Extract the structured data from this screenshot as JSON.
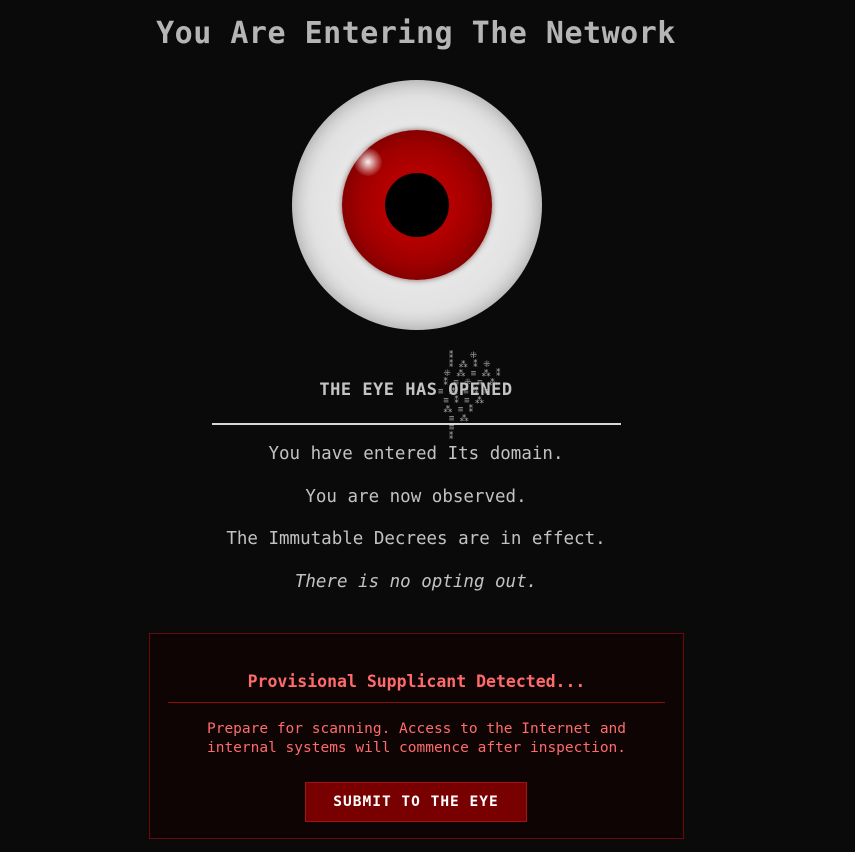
{
  "page": {
    "title": "You Are Entering The Network"
  },
  "eye": {
    "sclera_color": "#e6e6e6",
    "iris_color": "#b00000",
    "pupil_color": "#000000"
  },
  "status": {
    "heading": "THE EYE HAS OPENED"
  },
  "messages": {
    "line1": "You have entered Its domain.",
    "line2": "You are now observed.",
    "line3": "The Immutable Decrees are in effect.",
    "line4": "There is no opting out."
  },
  "panel": {
    "title": "Provisional Supplicant Detected...",
    "body": "Prepare for scanning. Access to the Internet and internal systems will commence after inspection.",
    "button_label": "SUBMIT TO THE EYE",
    "accent_color": "#ff6b6b",
    "border_color": "#6a0a0a"
  }
}
